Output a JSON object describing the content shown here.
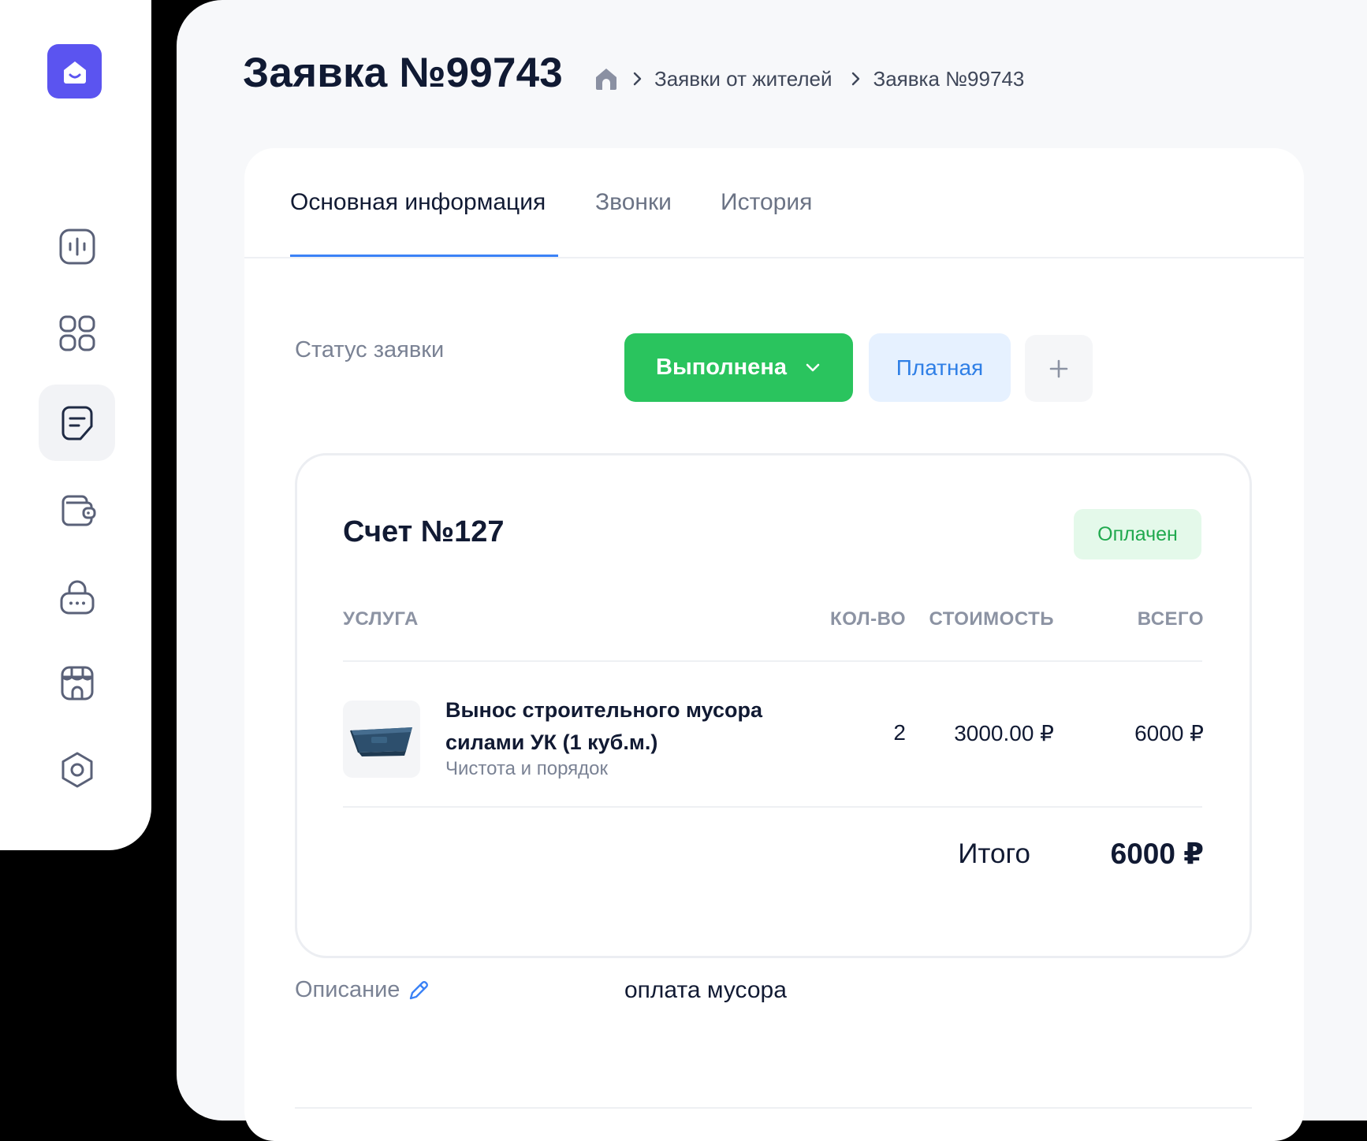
{
  "sidebar": {
    "logo_icon": "house-smile-icon",
    "items": [
      {
        "icon": "stats-icon",
        "active": false
      },
      {
        "icon": "grid-icon",
        "active": false
      },
      {
        "icon": "document-icon",
        "active": true
      },
      {
        "icon": "wallet-icon",
        "active": false
      },
      {
        "icon": "lock-icon",
        "active": false
      },
      {
        "icon": "store-icon",
        "active": false
      },
      {
        "icon": "settings-icon",
        "active": false
      }
    ]
  },
  "header": {
    "title": "Заявка №99743",
    "breadcrumb": [
      "Заявки от жителей",
      "Заявка №99743"
    ]
  },
  "tabs": [
    "Основная информация",
    "Звонки",
    "История"
  ],
  "status": {
    "label": "Статус заявки",
    "value": "Выполнена",
    "tag": "Платная",
    "add": "+"
  },
  "invoice": {
    "title": "Счет №127",
    "badge": "Оплачен",
    "columns": {
      "service": "УСЛУГА",
      "qty": "КОЛ-ВО",
      "price": "СТОИМОСТЬ",
      "total": "ВСЕГО"
    },
    "rows": [
      {
        "name": "Вынос строительного мусора силами УК (1 куб.м.)",
        "category": "Чистота и порядок",
        "qty": "2",
        "price": "3000.00 ₽",
        "total": "6000 ₽"
      }
    ],
    "total_label": "Итого",
    "total_value": "6000 ₽"
  },
  "description": {
    "label": "Описание",
    "value": "оплата мусора"
  },
  "colors": {
    "accent": "#5b54f0",
    "status_green": "#2ac45e",
    "tab_underline": "#3b82f6",
    "paid_text": "#20a94e"
  }
}
